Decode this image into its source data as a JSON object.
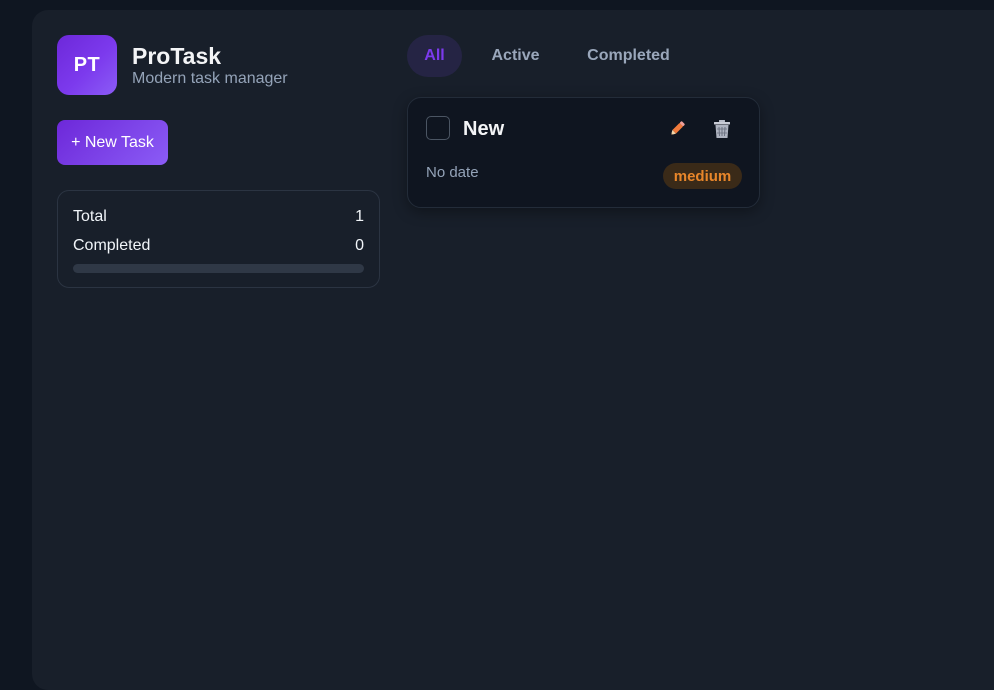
{
  "brand": {
    "logo_initials": "PT",
    "title": "ProTask",
    "subtitle": "Modern task manager"
  },
  "actions": {
    "new_task_label": "+ New Task"
  },
  "stats": {
    "total_label": "Total",
    "total_value": "1",
    "completed_label": "Completed",
    "completed_value": "0",
    "progress_fraction": 0
  },
  "filters": {
    "tabs": [
      {
        "label": "All",
        "selected": true
      },
      {
        "label": "Active",
        "selected": false
      },
      {
        "label": "Completed",
        "selected": false
      }
    ]
  },
  "tasks": [
    {
      "title": "New",
      "date": "No date",
      "priority": "medium",
      "done": false,
      "edit_icon": "pencil-icon",
      "delete_icon": "trash-icon"
    }
  ],
  "colors": {
    "accent": "#7c3aed",
    "priority_medium": "#e8862a",
    "background": "#181f2a"
  }
}
